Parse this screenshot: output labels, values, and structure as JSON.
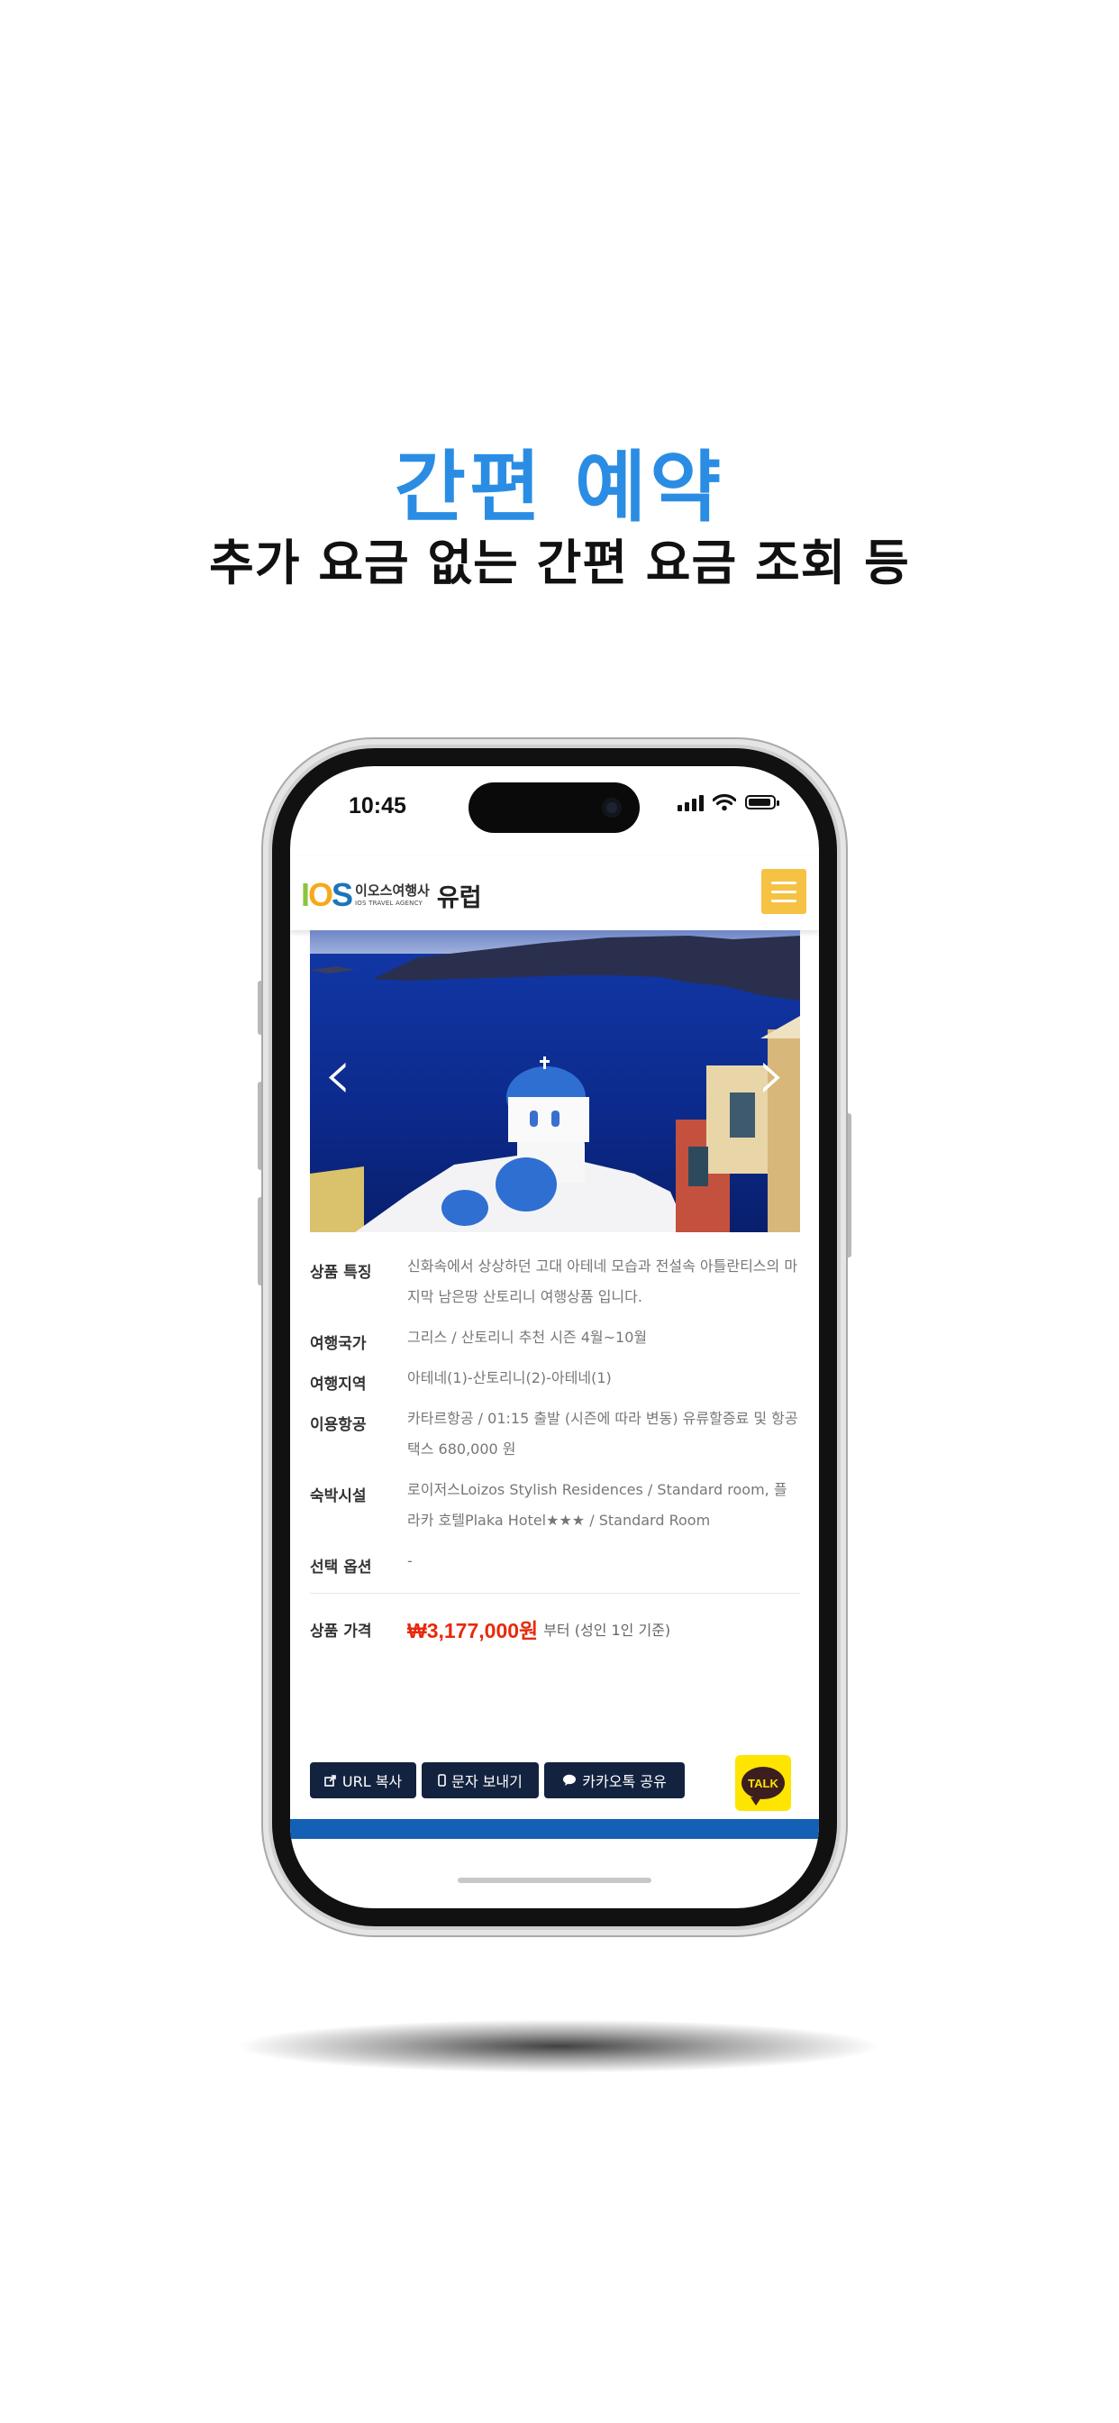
{
  "promo": {
    "headline": "간편 예약",
    "subline": "추가 요금 없는 간편 요금 조회 등"
  },
  "status_bar": {
    "time": "10:45"
  },
  "app_header": {
    "logo_mark": "IOS",
    "logo_korean": "이오스여행사",
    "logo_english": "IOS TRAVEL AGENCY",
    "region": "유럽",
    "menu_icon": "hamburger-icon",
    "menu_color": "#f6c244"
  },
  "carousel": {
    "prev_icon": "chevron-left-icon",
    "next_icon": "chevron-right-icon",
    "prev_glyph": "‹",
    "next_glyph": "›"
  },
  "details": {
    "rows": [
      {
        "label": "상품 특징",
        "value": "신화속에서 상상하던 고대 아테네 모습과 전설속 아틀란티스의 마지막 남은땅 산토리니 여행상품 입니다."
      },
      {
        "label": "여행국가",
        "value": "그리스 / 산토리니 추천 시즌 4월~10월"
      },
      {
        "label": "여행지역",
        "value": "아테네(1)-산토리니(2)-아테네(1)"
      },
      {
        "label": "이용항공",
        "value": "카타르항공 / 01:15 출발 (시즌에 따라 변동) 유류할증료 및 항공 택스 680,000 원"
      },
      {
        "label": "숙박시설",
        "value": "로이저스Loizos Stylish Residences / Standard room, 플라카 호텔Plaka Hotel★★★ / Standard Room"
      },
      {
        "label": "선택 옵션",
        "value": "-"
      }
    ],
    "price_label": "상품 가격",
    "price_amount": "₩3,177,000원",
    "price_suffix": "부터 (성인 1인 기준)",
    "price_color": "#e8290b"
  },
  "share": {
    "url_copy": "URL 복사",
    "sms": "문자 보내기",
    "kakao": "카카오톡 공유",
    "talk_label": "TALK",
    "button_color": "#13233f"
  }
}
